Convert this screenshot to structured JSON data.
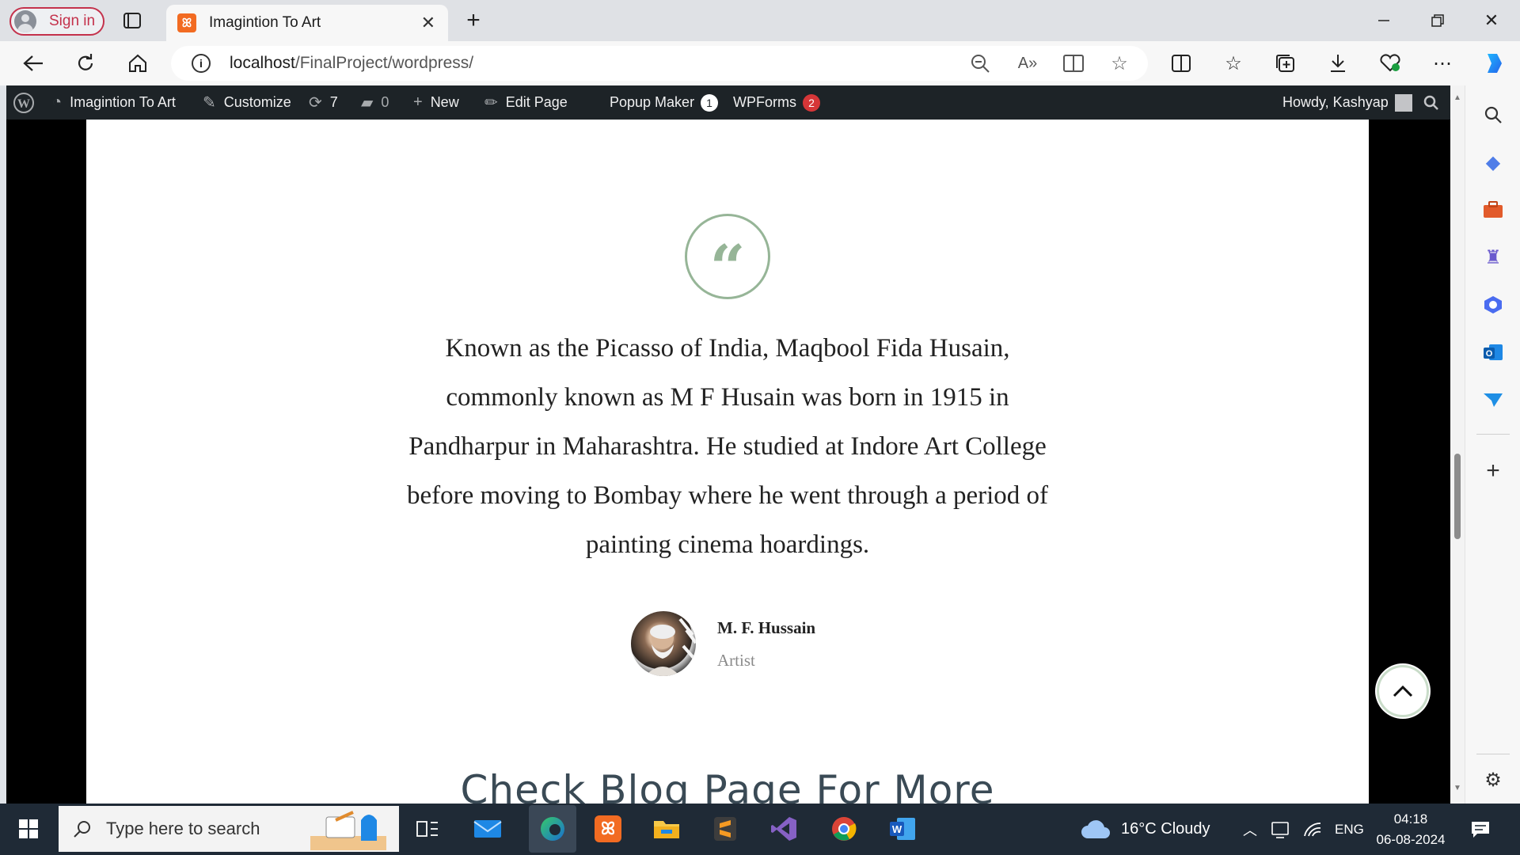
{
  "browser": {
    "signin_label": "Sign in",
    "tab_title": "Imagintion To Art",
    "tab_favicon": "XAMPP",
    "url_host": "localhost",
    "url_path": "/FinalProject/wordpress/"
  },
  "wpbar": {
    "site_name": "Imagintion To Art",
    "customize": "Customize",
    "updates_count": "7",
    "comments_count": "0",
    "new_label": "New",
    "edit_page": "Edit Page",
    "popup_maker": "Popup Maker",
    "popup_badge": "1",
    "wpforms": "WPForms",
    "wpforms_badge": "2",
    "howdy": "Howdy, Kashyap"
  },
  "page": {
    "quote_mark": "“",
    "quote": "Known as the Picasso of India, Maqbool Fida Husain, commonly known as M F Husain was born in 1915 in Pandharpur in Maharashtra. He studied at Indore Art College before moving to Bombay where he went through a period of painting cinema hoardings.",
    "author_name": "M. F. Hussain",
    "author_role": "Artist",
    "blog_heading": "Check Blog Page For More"
  },
  "taskbar": {
    "search_placeholder": "Type here to search",
    "weather": "16°C  Cloudy",
    "language": "ENG",
    "time": "04:18",
    "date": "06-08-2024"
  },
  "colors": {
    "accent_green": "#96b597",
    "wp_bar": "#1d2327",
    "taskbar": "#1f2a36",
    "badge_red": "#d63638"
  }
}
